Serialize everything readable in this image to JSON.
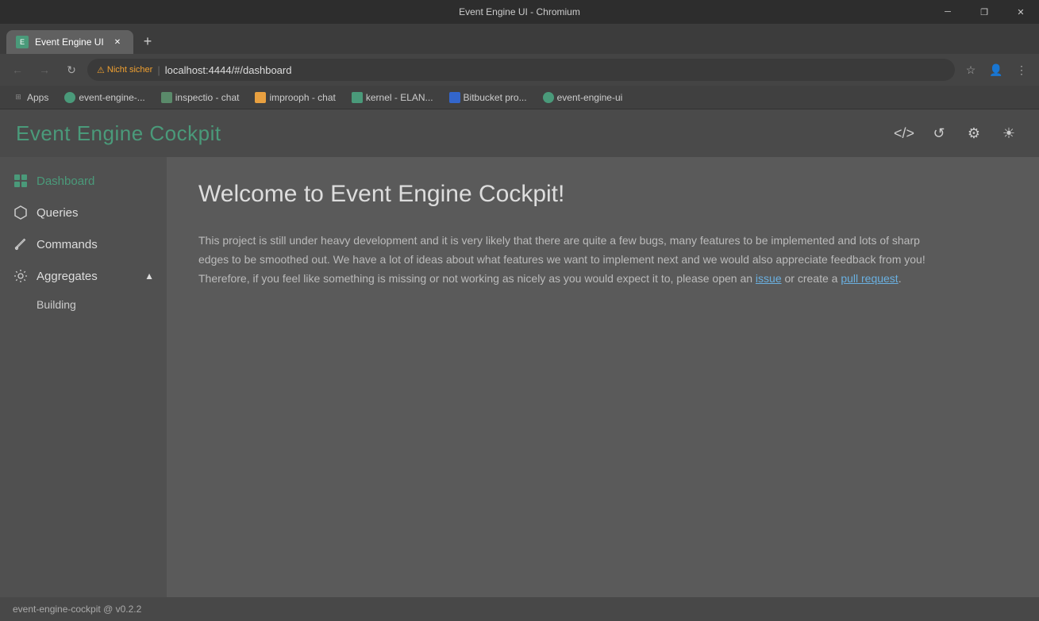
{
  "browser": {
    "title": "Event Engine UI - Chromium",
    "tab_label": "Event Engine UI",
    "tab_favicon_text": "E",
    "url_security": "Nicht sicher",
    "url_address": "localhost:4444/#/dashboard",
    "bookmarks": [
      {
        "label": "Apps",
        "color": "#888"
      },
      {
        "label": "event-engine-...",
        "color": "#4a9"
      },
      {
        "label": "inspectio - chat",
        "color": "#5a8"
      },
      {
        "label": "improoph - chat",
        "color": "#e84"
      },
      {
        "label": "kernel - ELAN...",
        "color": "#4a9"
      },
      {
        "label": "Bitbucket pro...",
        "color": "#36c"
      },
      {
        "label": "event-engine-ui",
        "color": "#4a9"
      }
    ]
  },
  "app": {
    "header_title": "Event Engine Cockpit",
    "header_icons": {
      "code": "</>",
      "refresh": "↺",
      "settings": "⚙",
      "theme": "☀"
    }
  },
  "sidebar": {
    "items": [
      {
        "id": "dashboard",
        "label": "Dashboard",
        "active": true
      },
      {
        "id": "queries",
        "label": "Queries"
      },
      {
        "id": "commands",
        "label": "Commands"
      },
      {
        "id": "aggregates",
        "label": "Aggregates"
      }
    ],
    "sub_items": [
      {
        "label": "Building"
      }
    ]
  },
  "main": {
    "welcome_title": "Welcome to Event Engine Cockpit!",
    "welcome_body_1": "This project is still under heavy development and it is very likely that there are quite a few bugs, many features to be implemented and lots of sharp edges to be smoothed out. We have a lot of ideas about what features we want to implement next and we would also appreciate feedback from you! Therefore, if you feel like something is missing or not working as nicely as you would expect it to, please open an ",
    "issue_link": "issue",
    "welcome_body_2": " or create a ",
    "pr_link": "pull request",
    "welcome_body_3": "."
  },
  "footer": {
    "version": "event-engine-cockpit @ v0.2.2"
  }
}
